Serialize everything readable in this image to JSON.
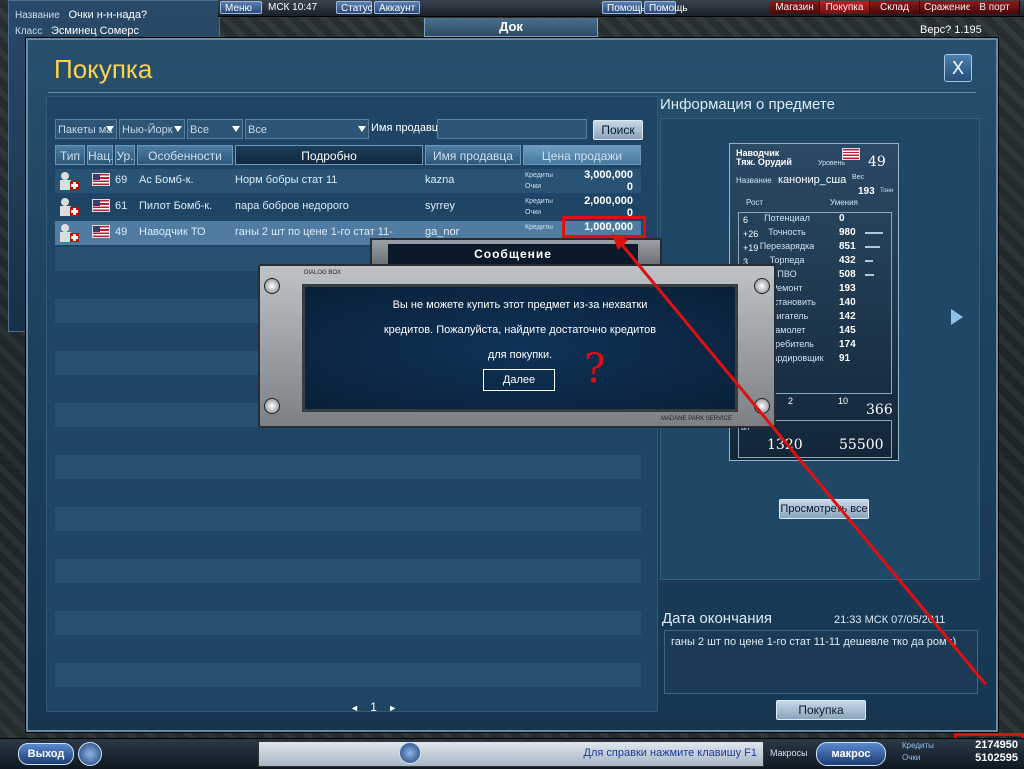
{
  "topbar": {
    "menu": "Меню",
    "time": "МСК 10:47",
    "status": "Статус",
    "account": "Аккаунт",
    "help": "Помощь",
    "help2": "Помощь",
    "tabs": [
      "Магазин",
      "Покупка",
      "Склад",
      "Сражение",
      "В порт"
    ],
    "active_tab": "Покупка",
    "version": "Верс? 1.195"
  },
  "dock_label": "Док",
  "left_panel": {
    "name_label": "Название",
    "name_value": "Очки н-н-нада?",
    "class_label": "Класс",
    "class_value": "Эсминец Сомерс"
  },
  "window": {
    "title": "Покупка",
    "close": "X"
  },
  "filters": {
    "packages": "Пакеты ма",
    "city": "Нью-Йорк",
    "type": "Все",
    "subtype": "Все",
    "seller_label": "Имя продавца",
    "seller_value": "",
    "search_button": "Поиск"
  },
  "table": {
    "headers": [
      "Тип",
      "Нац.",
      "Ур.",
      "Особенности",
      "Подробно",
      "Имя продавца",
      "Цена продажи"
    ],
    "credits_label": "Кредиты",
    "points_label": "Очки",
    "rows": [
      {
        "level": "69",
        "name": "Ас Бомб-к.",
        "details": "Норм бобры стат 11",
        "seller": "kazna",
        "credits": "3,000,000",
        "points": "0"
      },
      {
        "level": "61",
        "name": "Пилот Бомб-к.",
        "details": "пара бобров недорого",
        "seller": "syrrey",
        "credits": "2,000,000",
        "points": "0"
      },
      {
        "level": "49",
        "name": "Наводчик ТО",
        "details": "ганы 2 шт по цене 1-го стат 11-",
        "seller": "ga_nor",
        "credits": "1,000,000",
        "points": ""
      }
    ]
  },
  "pager": {
    "prev": "◄",
    "page": "1",
    "next": "►"
  },
  "info": {
    "title": "Информация о предмете",
    "card": {
      "role": "Наводчик",
      "sub": "Тяж. Орудий",
      "level_label": "Уровень",
      "level": "49",
      "name_label": "Название",
      "name": "канонир_сша",
      "weight_label": "Вес",
      "weight": "193",
      "weight_unit": "Тонн",
      "col_growth": "Рост",
      "col_skills": "Умения",
      "growth": [
        "6",
        "+26",
        "+19",
        "3"
      ],
      "stats": [
        {
          "label": "Потенциал",
          "value": "0"
        },
        {
          "label": "Точность",
          "value": "980"
        },
        {
          "label": "Перезарядка",
          "value": "851"
        },
        {
          "label": "Торпеда",
          "value": "432"
        },
        {
          "label": "ПВО",
          "value": "508"
        },
        {
          "label": "Ремонт",
          "value": "193"
        },
        {
          "label": "Восстановить",
          "value": "140"
        },
        {
          "label": "Двигатель",
          "value": "142"
        },
        {
          "label": "Самолет",
          "value": "145"
        },
        {
          "label": "Истребитель",
          "value": "174"
        },
        {
          "label": "Бомбардировщик",
          "value": "91"
        }
      ],
      "crew_a": "2",
      "crew_b": "10",
      "total": "366",
      "exp_label": "ыт",
      "exp_now": "1320",
      "exp_max": "55500"
    },
    "view_all": "Просмотреть все",
    "end_label": "Дата окончания",
    "end_date": "21:33 МСК 07/05/2011",
    "description": "ганы 2 шт по цене 1-го стат 11-11 дешевле тко да ром :)",
    "buy_button": "Покупка"
  },
  "dialog": {
    "title": "Сообщение",
    "line1": "Вы не можете купить этот предмет из-за нехватки",
    "line2": "кредитов. Пожалуйста, найдите достаточно кредитов",
    "line3": "для покупки.",
    "button": "Далее",
    "box_label": "DIALOG BOX",
    "box_label2": "MADANE PARK SERVICE"
  },
  "annotation": "?",
  "bottom": {
    "exit": "Выход",
    "help_text": "Для справки нажмите клавишу F1",
    "macros_label": "Макросы",
    "macro_button": "макрос",
    "credits_label": "Кредиты",
    "points_label": "Очки",
    "credits": "2174950",
    "points": "5102595"
  },
  "colors": {
    "accent_title": "#ffd24a",
    "annotation_red": "#e01010",
    "window_bg": "#1d4260"
  }
}
